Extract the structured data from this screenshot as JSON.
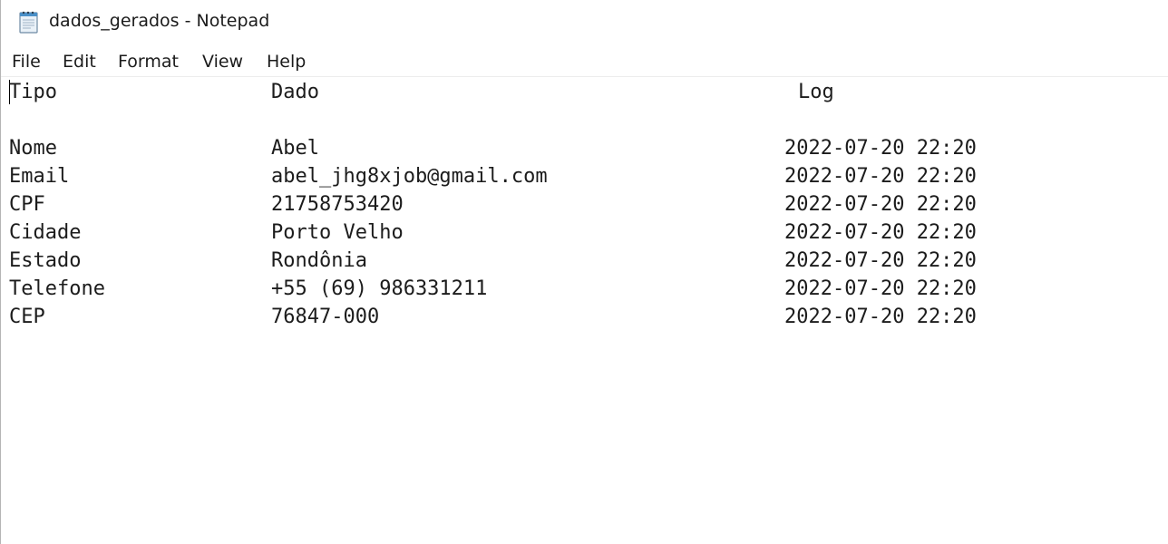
{
  "window": {
    "title": "dados_gerados - Notepad"
  },
  "icons": {
    "app_icon": "notepad-icon"
  },
  "menu": {
    "file": "File",
    "edit": "Edit",
    "format": "Format",
    "view": "View",
    "help": "Help"
  },
  "document": {
    "header": {
      "tipo": "Tipo",
      "dado": "Dado",
      "log": "Log"
    },
    "rows": [
      {
        "tipo": "Nome",
        "dado": "Abel",
        "log": "2022-07-20 22:20"
      },
      {
        "tipo": "Email",
        "dado": "abel_jhg8xjob@gmail.com",
        "log": "2022-07-20 22:20"
      },
      {
        "tipo": "CPF",
        "dado": "21758753420",
        "log": "2022-07-20 22:20"
      },
      {
        "tipo": "Cidade",
        "dado": "Porto Velho",
        "log": "2022-07-20 22:20"
      },
      {
        "tipo": "Estado",
        "dado": "Rondônia",
        "log": "2022-07-20 22:20"
      },
      {
        "tipo": "Telefone",
        "dado": "+55 (69) 986331211",
        "log": "2022-07-20 22:20"
      },
      {
        "tipo": "CEP",
        "dado": "76847-000",
        "log": "2022-07-20 22:20"
      }
    ]
  }
}
